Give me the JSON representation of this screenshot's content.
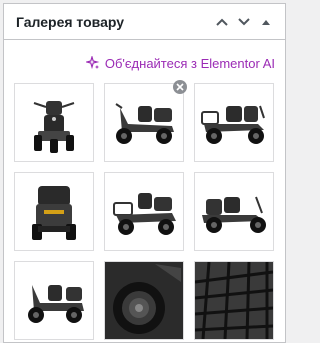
{
  "header": {
    "title": "Галерея товару",
    "icons": [
      "chevron-up-icon",
      "chevron-down-icon",
      "collapse-triangle-icon"
    ]
  },
  "ai": {
    "label": "Об'єднайтеся з Elementor AI",
    "icon": "sparkle-icon",
    "color": "#9b2bb5"
  },
  "gallery": {
    "items": [
      {
        "view": "front",
        "remove_visible": false
      },
      {
        "view": "side-left",
        "remove_visible": true
      },
      {
        "view": "side-right",
        "remove_visible": false
      },
      {
        "view": "rear",
        "remove_visible": false
      },
      {
        "view": "three-quarter-left",
        "remove_visible": false
      },
      {
        "view": "side-right-2",
        "remove_visible": false
      },
      {
        "view": "side-left-2",
        "remove_visible": false
      },
      {
        "view": "wheel-closeup",
        "remove_visible": false
      },
      {
        "view": "basket-closeup",
        "remove_visible": false
      }
    ]
  }
}
